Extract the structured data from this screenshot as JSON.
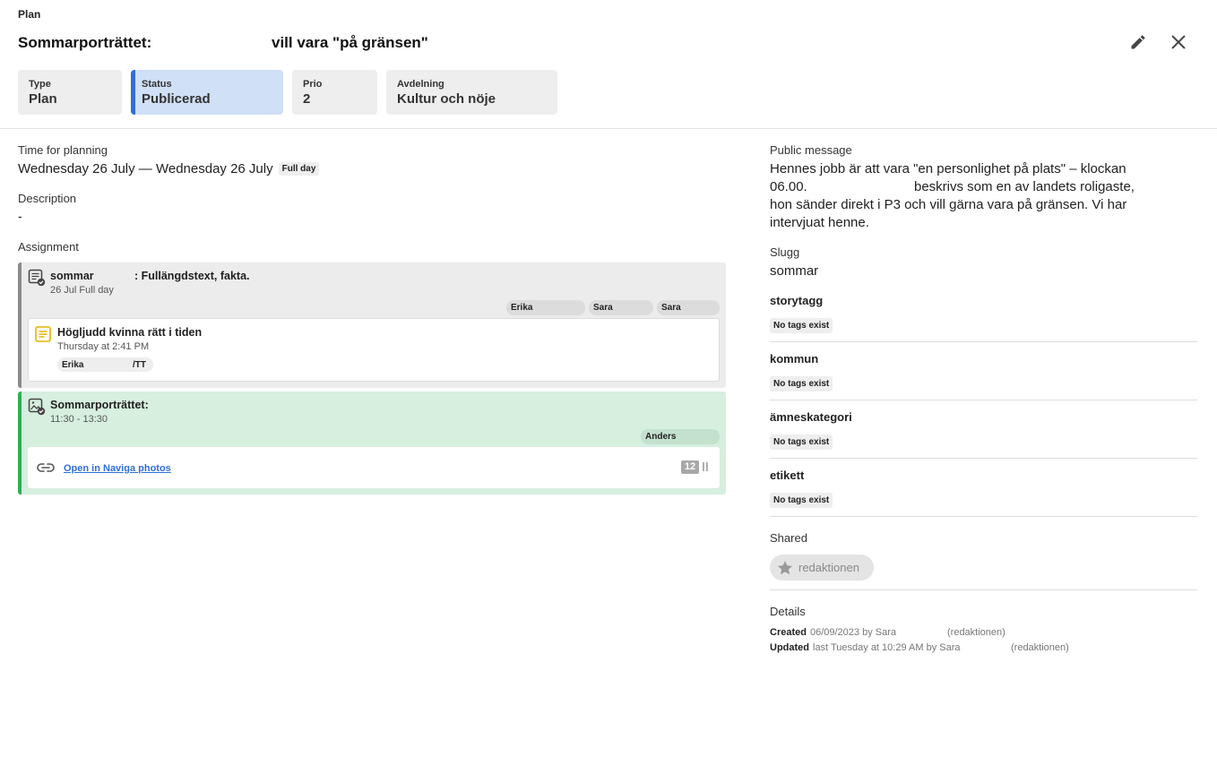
{
  "breadcrumb": "Plan",
  "title": {
    "part1": "Sommarporträttet:",
    "part2": "vill vara \"på gränsen\""
  },
  "icons": {
    "edit": "pencil-icon",
    "close": "close-icon"
  },
  "chips": {
    "type": {
      "label": "Type",
      "value": "Plan"
    },
    "status": {
      "label": "Status",
      "value": "Publicerad"
    },
    "prio": {
      "label": "Prio",
      "value": "2"
    },
    "avdelning": {
      "label": "Avdelning",
      "value": "Kultur och nöje"
    }
  },
  "planning": {
    "label": "Time for planning",
    "value": "Wednesday 26 July — Wednesday 26 July",
    "badge": "Full day"
  },
  "description": {
    "label": "Description",
    "value": "-"
  },
  "assignment": {
    "label": "Assignment",
    "items": [
      {
        "icon": "article-check-icon",
        "title_start": "sommar",
        "title_rest": ": Fullängdstext, fakta.",
        "subtitle": "26 Jul Full day",
        "assignees": [
          "Erika",
          "Sara",
          "Sara"
        ],
        "inner": {
          "icon": "document-icon",
          "title": "Högljudd kvinna rätt i tiden",
          "subtitle": "Thursday at 2:41 PM",
          "author": "Erika",
          "author_suffix": "/TT"
        }
      },
      {
        "icon": "image-check-icon",
        "title": "Sommarporträttet:",
        "subtitle": "11:30 - 13:30",
        "assignees": [
          "Anders"
        ],
        "inner": {
          "icon": "link-icon",
          "link_text": "Open in Naviga photos",
          "count": "12"
        }
      }
    ]
  },
  "public_message": {
    "label": "Public message",
    "line1": "Hennes jobb är att vara \"en personlighet på plats\" – klockan",
    "line2a": "06.00.",
    "line2b": "beskrivs som en av landets roligaste,",
    "line3": "hon sänder direkt i P3 och vill gärna vara på gränsen. Vi har",
    "line4": "intervjuat henne."
  },
  "slugg": {
    "label": "Slugg",
    "value": "sommar"
  },
  "tag_groups": [
    {
      "label": "storytagg",
      "value": "No tags exist"
    },
    {
      "label": "kommun",
      "value": "No tags exist"
    },
    {
      "label": "ämneskategori",
      "value": "No tags exist"
    },
    {
      "label": "etikett",
      "value": "No tags exist"
    }
  ],
  "shared": {
    "label": "Shared",
    "chip": "redaktionen",
    "icon": "star-icon"
  },
  "details": {
    "label": "Details",
    "created_label": "Created",
    "created_value": "06/09/2023 by Sara",
    "created_org": "(redaktionen)",
    "updated_label": "Updated",
    "updated_value": "last Tuesday at 10:29 AM by Sara",
    "updated_org": "(redaktionen)"
  }
}
